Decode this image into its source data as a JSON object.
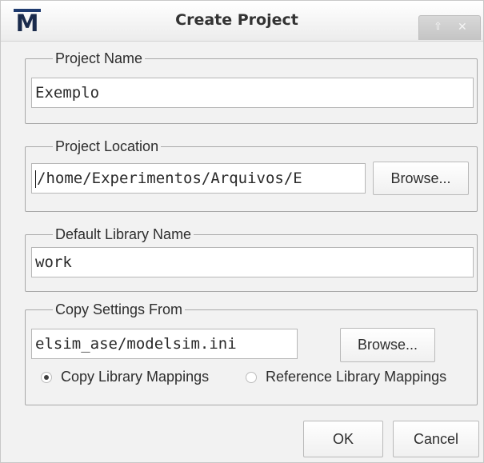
{
  "window": {
    "title": "Create Project",
    "logo_letter": "M",
    "controls": {
      "up_glyph": "⇧",
      "close_glyph": "✕"
    }
  },
  "project_name": {
    "label": "Project Name",
    "value": "Exemplo"
  },
  "project_location": {
    "label": "Project Location",
    "value": "/home/Experimentos/Arquivos/E",
    "browse_label": "Browse..."
  },
  "default_library": {
    "label": "Default Library Name",
    "value": "work"
  },
  "copy_settings": {
    "label": "Copy Settings From",
    "value": "elsim_ase/modelsim.ini",
    "browse_label": "Browse...",
    "options": [
      {
        "label": "Copy Library Mappings",
        "selected": true
      },
      {
        "label": "Reference Library Mappings",
        "selected": false
      }
    ]
  },
  "footer": {
    "ok_label": "OK",
    "cancel_label": "Cancel"
  },
  "colors": {
    "logo_bar": "#1e3a6e",
    "logo_letter": "#1a2b4c",
    "dialog_bg": "#f2f2f2"
  },
  "icons": {
    "logo": "modelsim-m-logo",
    "up": "arrow-up-icon",
    "close": "close-icon"
  }
}
